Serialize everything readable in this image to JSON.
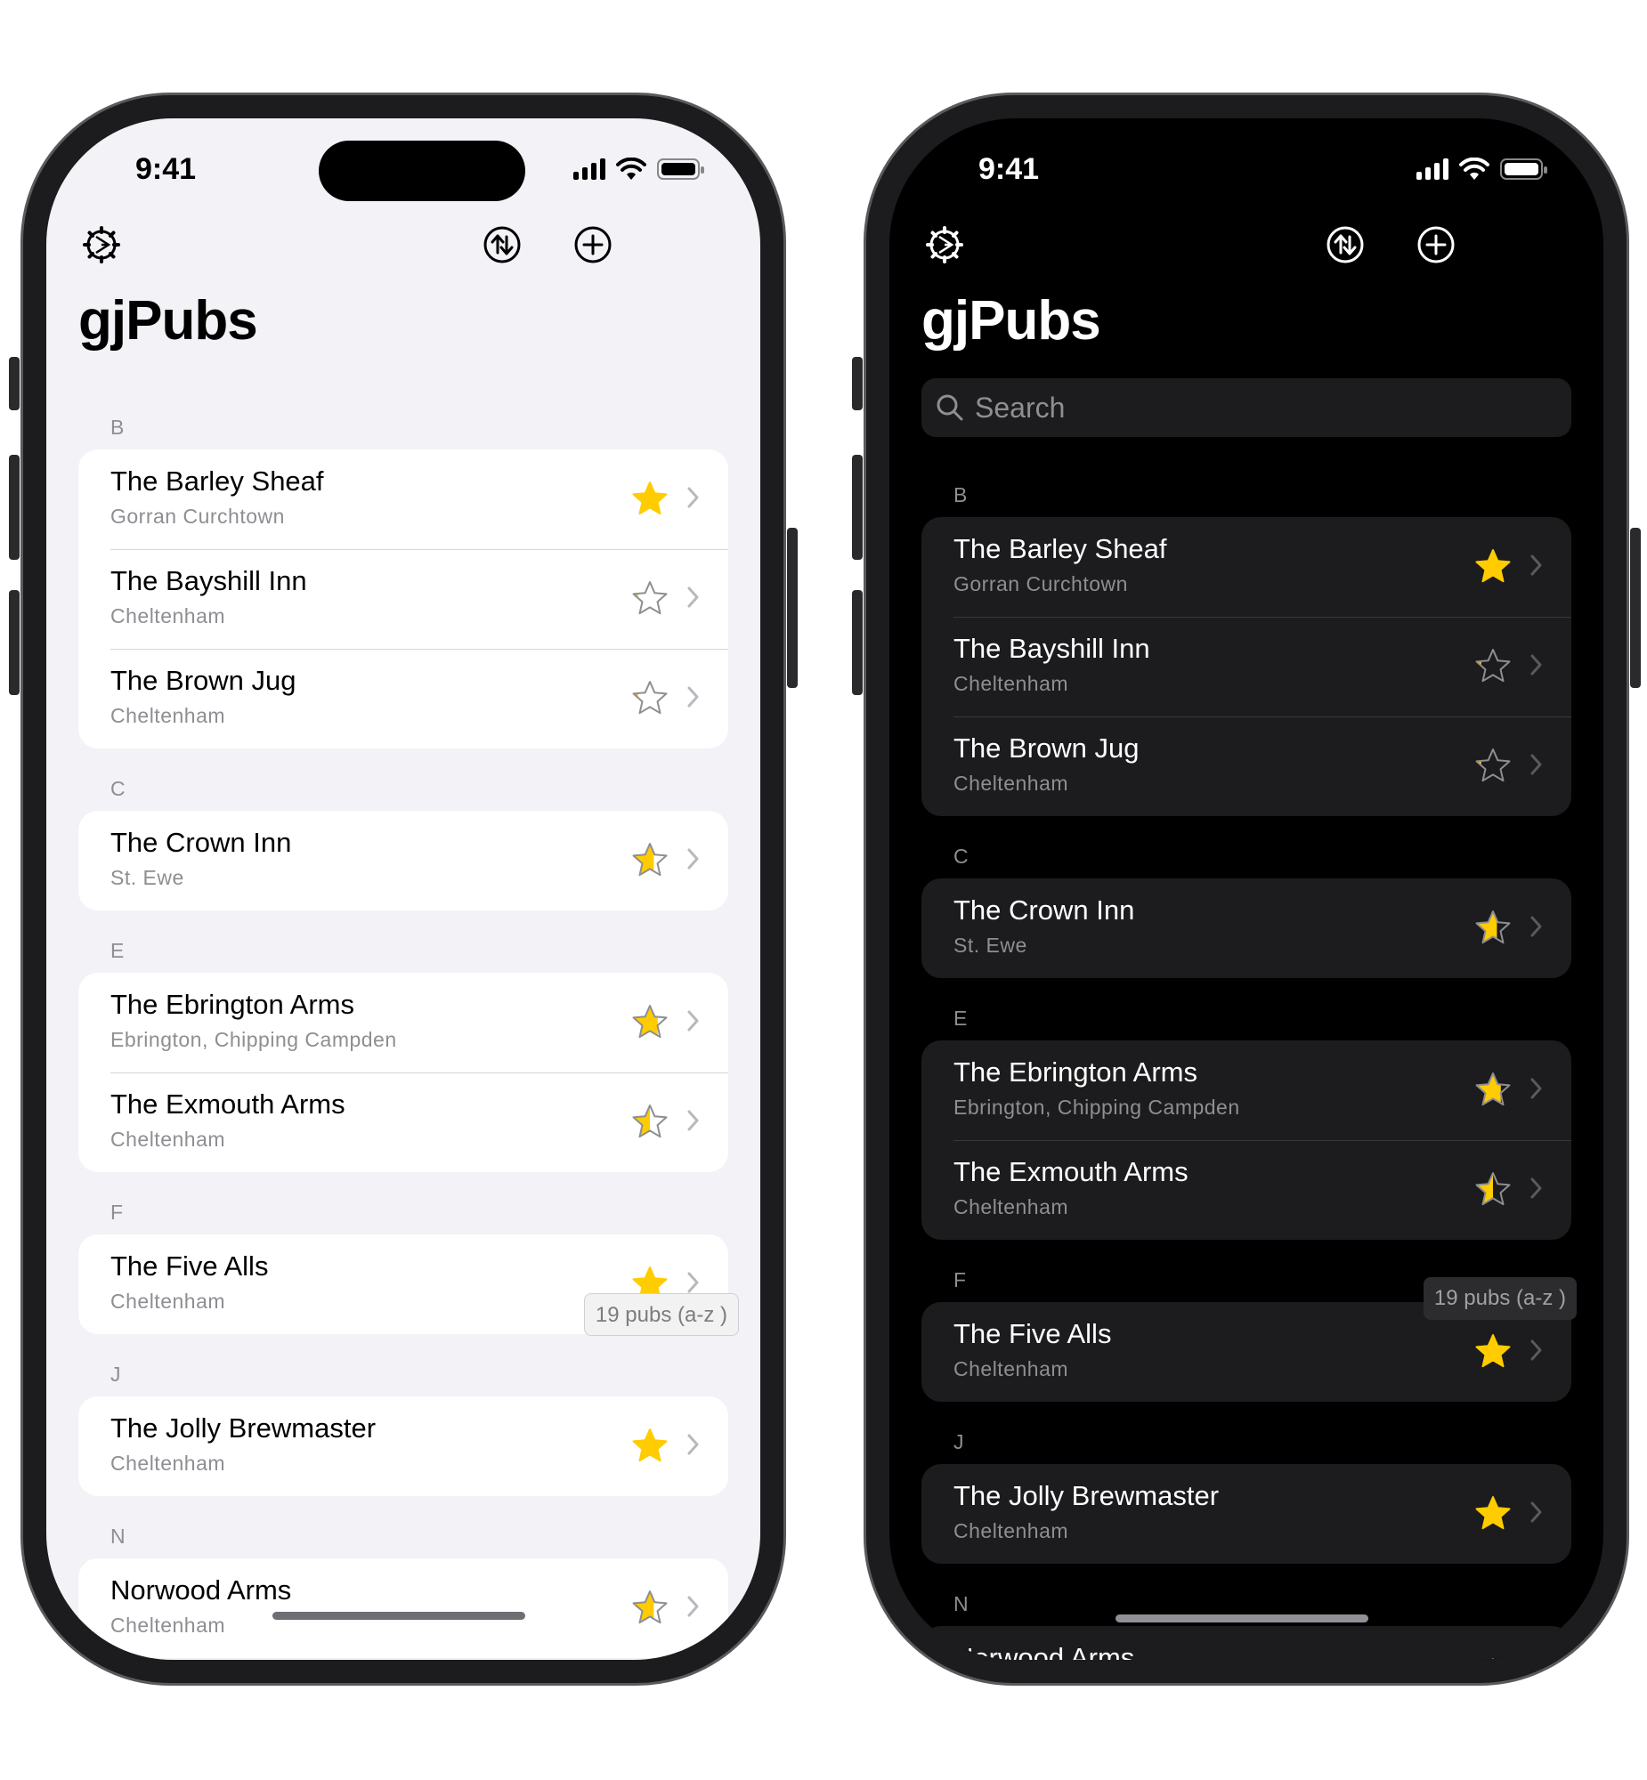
{
  "status_bar": {
    "time": "9:41"
  },
  "app": {
    "title": "gjPubs",
    "search_placeholder": "Search",
    "count_badge": "19 pubs (a-z )"
  },
  "icons": {
    "settings": "gear-icon",
    "sort": "sort-arrows-icon",
    "add": "plus-circle-icon",
    "star": "star-icon",
    "chevron": "chevron-right-icon"
  },
  "colors": {
    "star_yellow": "#ffcc00",
    "light_background": "#f2f2f7",
    "dark_background": "#000000",
    "dark_cell": "#1c1c1e"
  },
  "sections": [
    {
      "letter": "B",
      "pubs": [
        {
          "name": "The Barley Sheaf",
          "location": "Gorran Curchtown",
          "rating": 1.0
        },
        {
          "name": "The Bayshill Inn",
          "location": "Cheltenham",
          "rating": 0.2
        },
        {
          "name": "The Brown Jug",
          "location": "Cheltenham",
          "rating": 0.2
        }
      ]
    },
    {
      "letter": "C",
      "pubs": [
        {
          "name": "The Crown Inn",
          "location": "St. Ewe",
          "rating": 0.6
        }
      ]
    },
    {
      "letter": "E",
      "pubs": [
        {
          "name": "The Ebrington Arms",
          "location": "Ebrington, Chipping Campden",
          "rating": 0.7
        },
        {
          "name": "The Exmouth Arms",
          "location": "Cheltenham",
          "rating": 0.5
        }
      ]
    },
    {
      "letter": "F",
      "pubs": [
        {
          "name": "The Five Alls",
          "location": "Cheltenham",
          "rating": 1.0
        }
      ]
    },
    {
      "letter": "J",
      "pubs": [
        {
          "name": "The Jolly Brewmaster",
          "location": "Cheltenham",
          "rating": 1.0
        }
      ]
    },
    {
      "letter": "N",
      "pubs": [
        {
          "name": "Norwood Arms",
          "location": "Cheltenham",
          "rating": 0.6
        }
      ]
    }
  ]
}
